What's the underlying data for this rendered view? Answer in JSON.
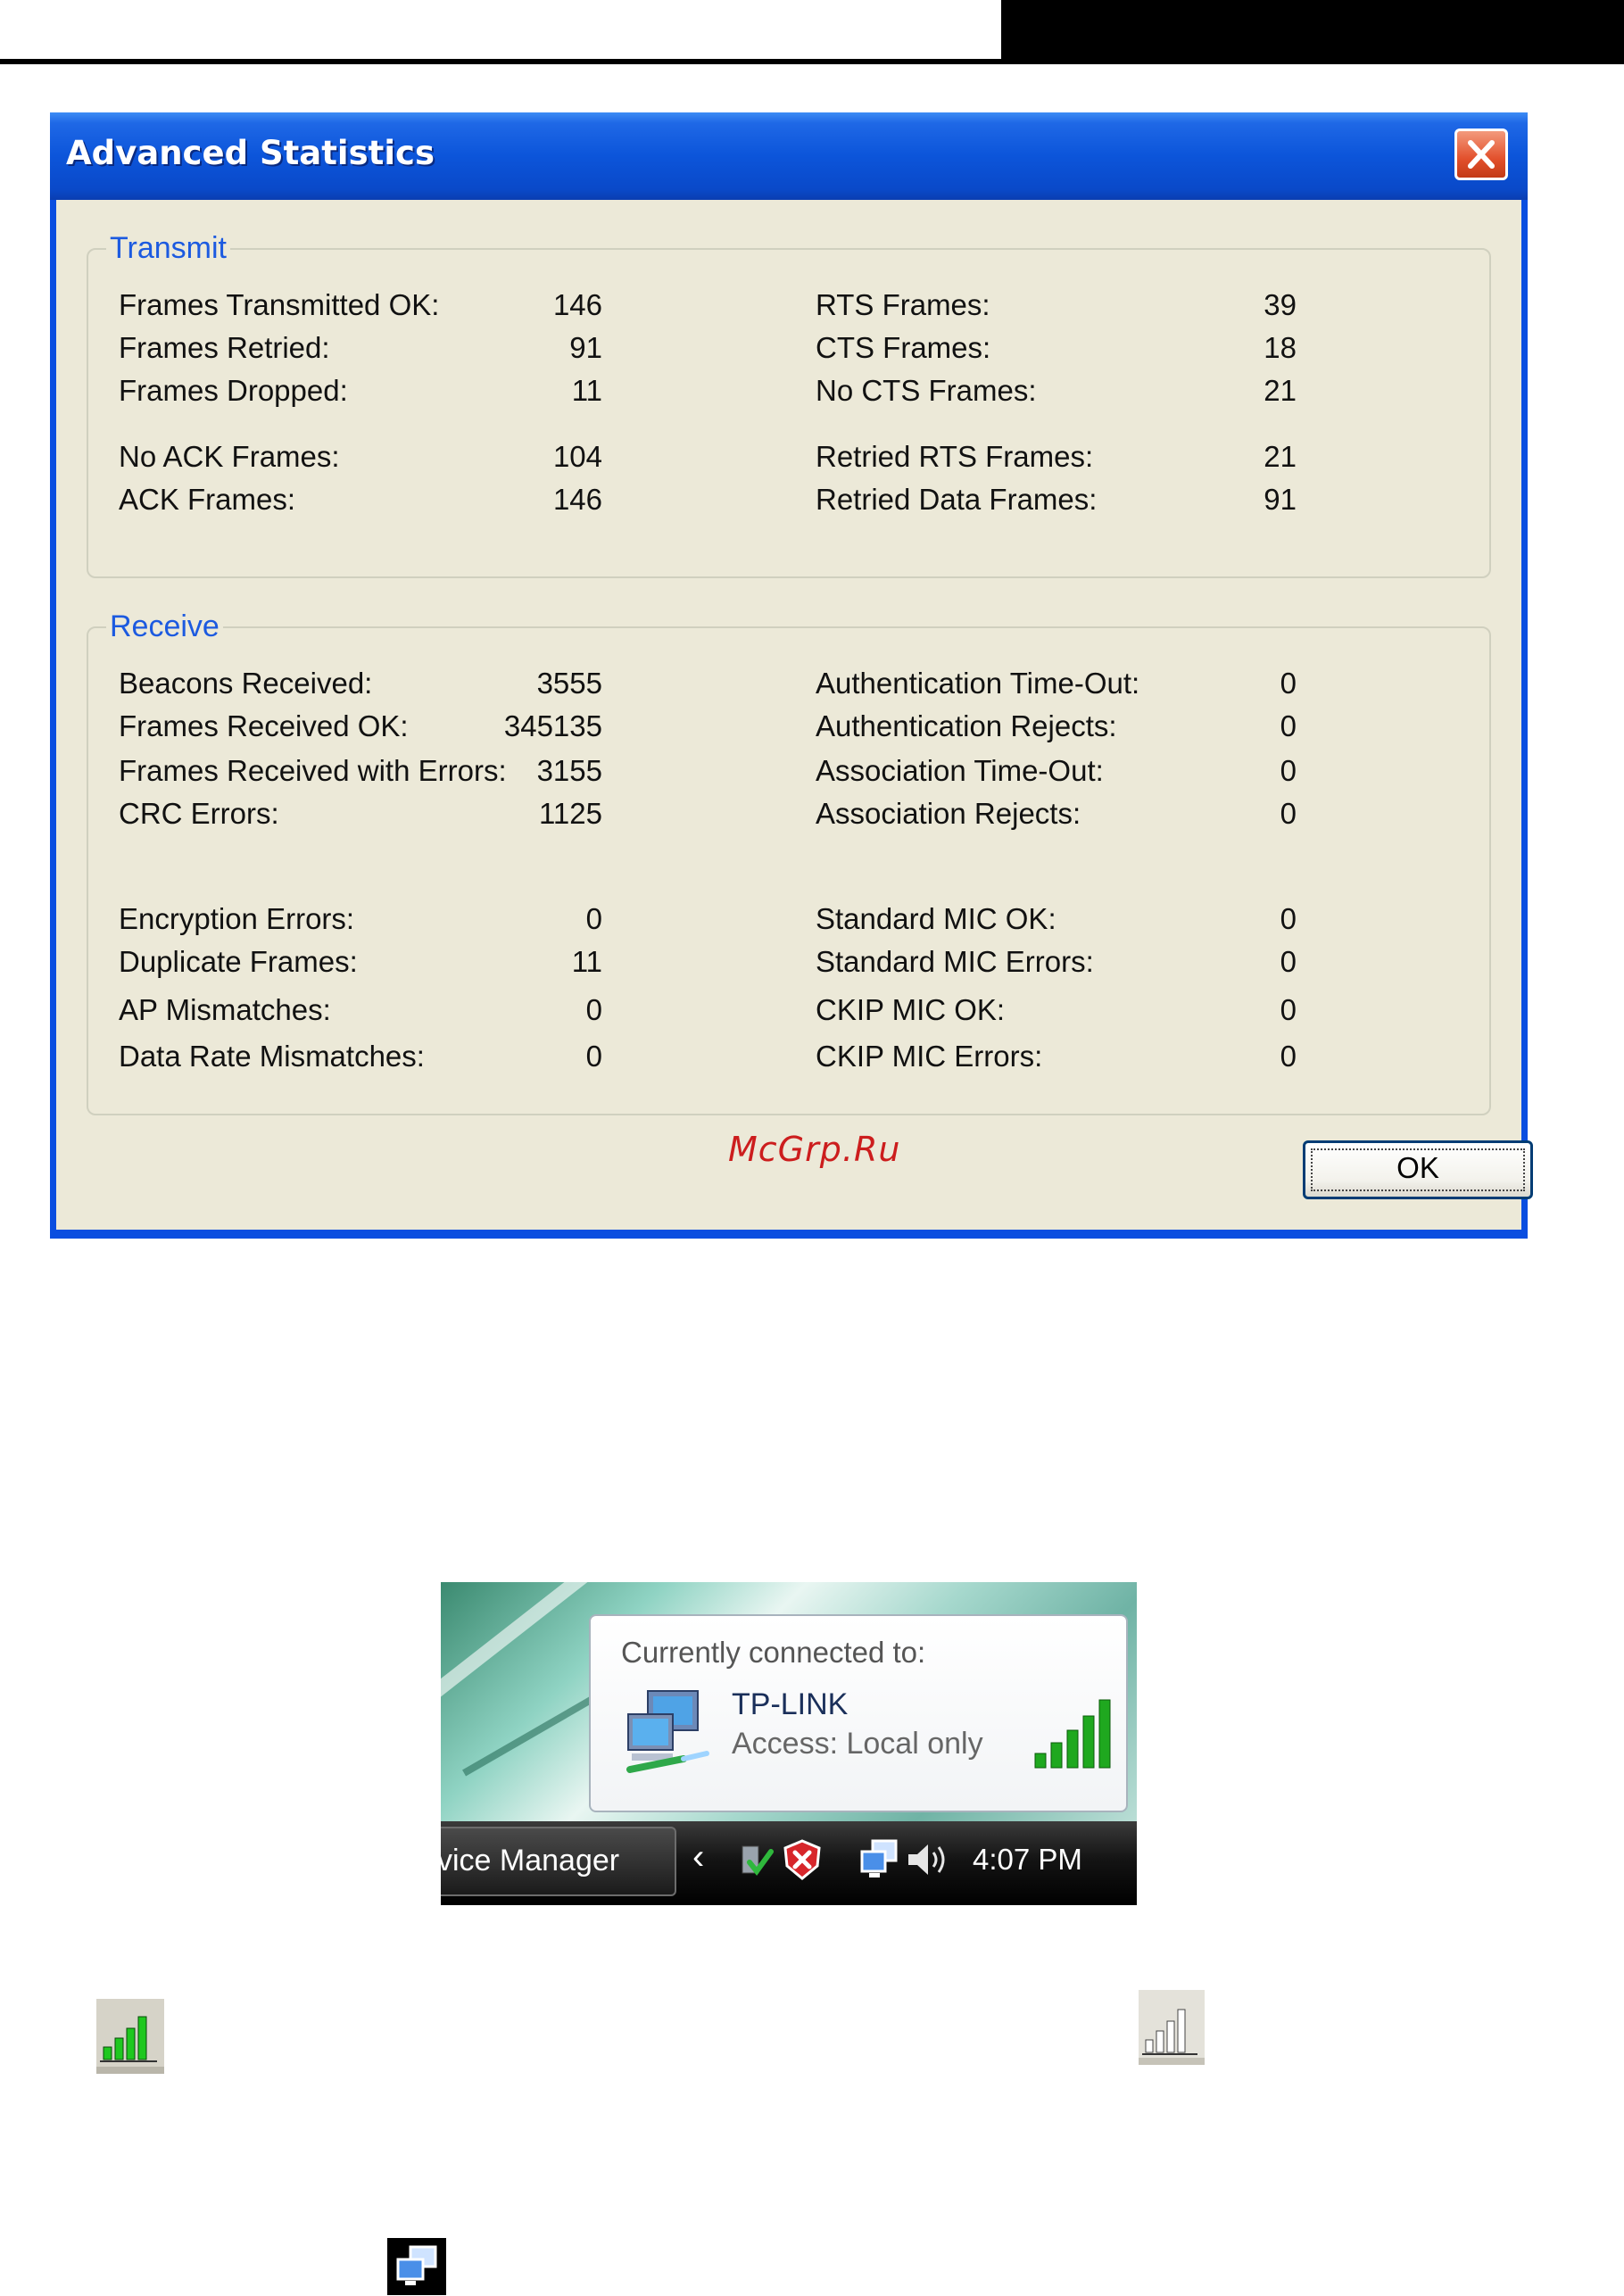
{
  "dialog": {
    "title": "Advanced Statistics",
    "ok_label": "OK",
    "transmit": {
      "label": "Transmit",
      "left": [
        {
          "label": "Frames Transmitted OK:",
          "value": "146"
        },
        {
          "label": "Frames Retried:",
          "value": "91"
        },
        {
          "label": "Frames Dropped:",
          "value": "11"
        },
        {
          "label": "No ACK Frames:",
          "value": "104"
        },
        {
          "label": "ACK Frames:",
          "value": "146"
        }
      ],
      "right": [
        {
          "label": "RTS Frames:",
          "value": "39"
        },
        {
          "label": "CTS Frames:",
          "value": "18"
        },
        {
          "label": "No CTS Frames:",
          "value": "21"
        },
        {
          "label": "Retried RTS Frames:",
          "value": "21"
        },
        {
          "label": "Retried Data Frames:",
          "value": "91"
        }
      ]
    },
    "receive": {
      "label": "Receive",
      "left": [
        {
          "label": "Beacons Received:",
          "value": "3555"
        },
        {
          "label": "Frames Received OK:",
          "value": "345135"
        },
        {
          "label": "Frames Received with Errors:",
          "value": "3155"
        },
        {
          "label": "CRC Errors:",
          "value": "1125"
        },
        {
          "label": "Encryption Errors:",
          "value": "0"
        },
        {
          "label": "Duplicate Frames:",
          "value": "11"
        },
        {
          "label": "AP Mismatches:",
          "value": "0"
        },
        {
          "label": "Data Rate Mismatches:",
          "value": "0"
        }
      ],
      "right": [
        {
          "label": "Authentication Time-Out:",
          "value": "0"
        },
        {
          "label": "Authentication Rejects:",
          "value": "0"
        },
        {
          "label": "Association Time-Out:",
          "value": "0"
        },
        {
          "label": "Association Rejects:",
          "value": "0"
        },
        {
          "label": "Standard MIC OK:",
          "value": "0"
        },
        {
          "label": "Standard MIC Errors:",
          "value": "0"
        },
        {
          "label": "CKIP MIC OK:",
          "value": "0"
        },
        {
          "label": "CKIP MIC Errors:",
          "value": "0"
        }
      ]
    }
  },
  "watermark": "McGrp.Ru",
  "tray": {
    "heading": "Currently connected to:",
    "network_name": "TP-LINK",
    "access": "Access:  Local only",
    "taskbar_button": "vice Manager",
    "time": "4:07 PM"
  },
  "colors": {
    "title_blue": "#0a4ee0",
    "group_label": "#1c5ae0",
    "client_bg": "#ece9d8",
    "signal_green": "#1fa81f"
  },
  "icons": [
    "close-icon",
    "network-computers-icon",
    "signal-strength-icon",
    "security-alert-icon",
    "speaker-icon",
    "network-monitor-icon"
  ]
}
